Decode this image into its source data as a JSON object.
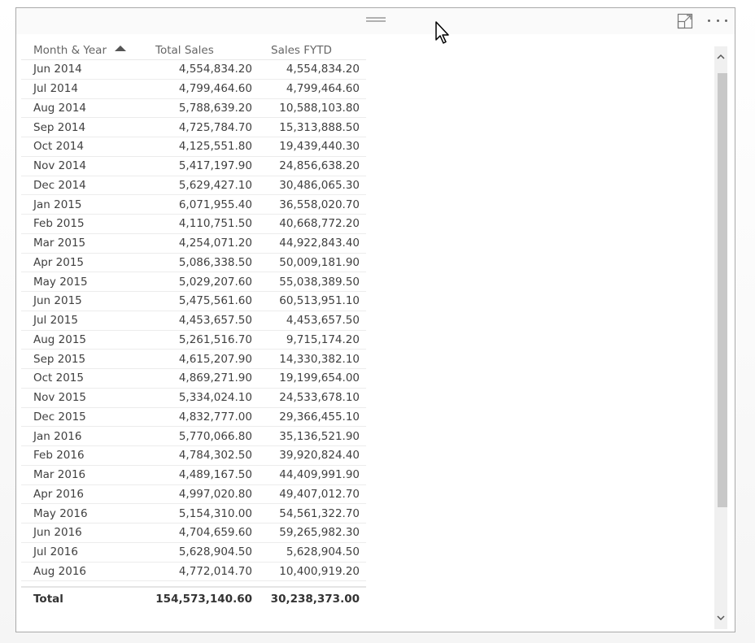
{
  "visual": {
    "header": {
      "grip_icon": "drag-handle-icon",
      "focus_mode_icon": "focus-mode-icon",
      "more_options_icon": "more-options-icon"
    },
    "table": {
      "columns": [
        "Month & Year",
        "Total Sales",
        "Sales FYTD"
      ],
      "sort": {
        "column": "Month & Year",
        "direction": "ascending"
      },
      "rows": [
        [
          "Jun 2014",
          "4,554,834.20",
          "4,554,834.20"
        ],
        [
          "Jul 2014",
          "4,799,464.60",
          "4,799,464.60"
        ],
        [
          "Aug 2014",
          "5,788,639.20",
          "10,588,103.80"
        ],
        [
          "Sep 2014",
          "4,725,784.70",
          "15,313,888.50"
        ],
        [
          "Oct 2014",
          "4,125,551.80",
          "19,439,440.30"
        ],
        [
          "Nov 2014",
          "5,417,197.90",
          "24,856,638.20"
        ],
        [
          "Dec 2014",
          "5,629,427.10",
          "30,486,065.30"
        ],
        [
          "Jan 2015",
          "6,071,955.40",
          "36,558,020.70"
        ],
        [
          "Feb 2015",
          "4,110,751.50",
          "40,668,772.20"
        ],
        [
          "Mar 2015",
          "4,254,071.20",
          "44,922,843.40"
        ],
        [
          "Apr 2015",
          "5,086,338.50",
          "50,009,181.90"
        ],
        [
          "May 2015",
          "5,029,207.60",
          "55,038,389.50"
        ],
        [
          "Jun 2015",
          "5,475,561.60",
          "60,513,951.10"
        ],
        [
          "Jul 2015",
          "4,453,657.50",
          "4,453,657.50"
        ],
        [
          "Aug 2015",
          "5,261,516.70",
          "9,715,174.20"
        ],
        [
          "Sep 2015",
          "4,615,207.90",
          "14,330,382.10"
        ],
        [
          "Oct 2015",
          "4,869,271.90",
          "19,199,654.00"
        ],
        [
          "Nov 2015",
          "5,334,024.10",
          "24,533,678.10"
        ],
        [
          "Dec 2015",
          "4,832,777.00",
          "29,366,455.10"
        ],
        [
          "Jan 2016",
          "5,770,066.80",
          "35,136,521.90"
        ],
        [
          "Feb 2016",
          "4,784,302.50",
          "39,920,824.40"
        ],
        [
          "Mar 2016",
          "4,489,167.50",
          "44,409,991.90"
        ],
        [
          "Apr 2016",
          "4,997,020.80",
          "49,407,012.70"
        ],
        [
          "May 2016",
          "5,154,310.00",
          "54,561,322.70"
        ],
        [
          "Jun 2016",
          "4,704,659.60",
          "59,265,982.30"
        ],
        [
          "Jul 2016",
          "5,628,904.50",
          "5,628,904.50"
        ],
        [
          "Aug 2016",
          "4,772,014.70",
          "10,400,919.20"
        ]
      ],
      "total": [
        "Total",
        "154,573,140.60",
        "30,238,373.00"
      ]
    },
    "scrollbar": {
      "up_icon": "chevron-up-icon",
      "down_icon": "chevron-down-icon",
      "position_fraction": 0.0,
      "visible_fraction": 0.95
    }
  },
  "colors": {
    "border": "#a9a9a9",
    "text": "#404040",
    "header_text": "#666666",
    "scroll_thumb": "#c8c8c8"
  }
}
